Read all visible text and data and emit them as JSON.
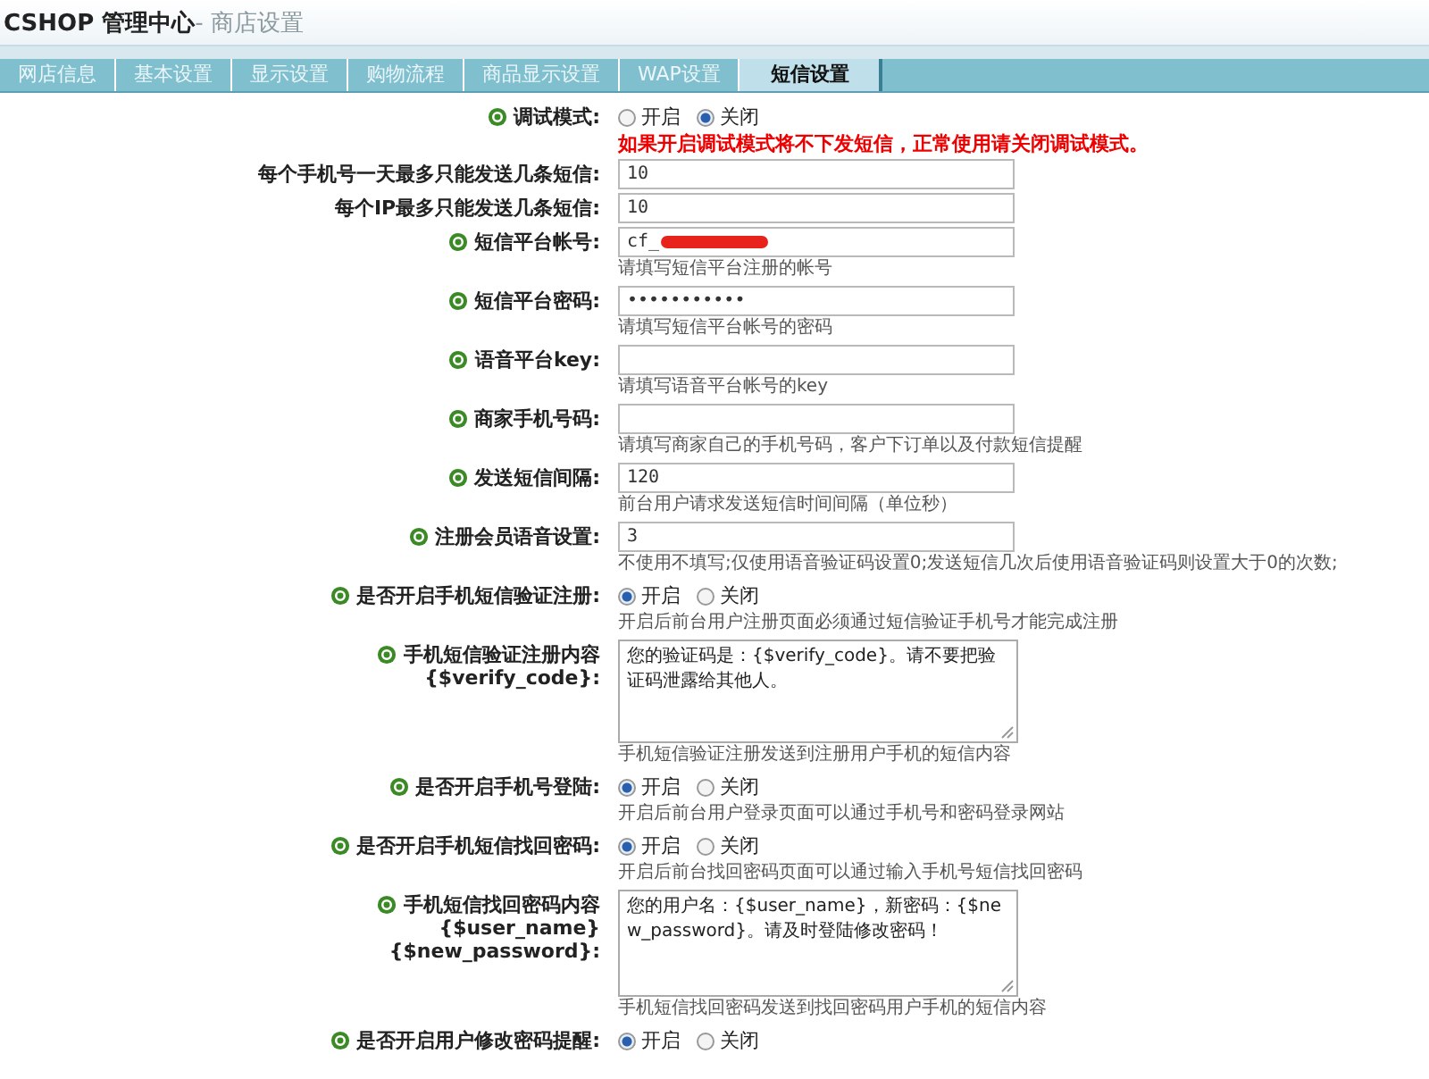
{
  "header": {
    "title": "CSHOP 管理中心",
    "subtitle": "- 商店设置"
  },
  "tabs": [
    {
      "label": "网店信息",
      "selected": false
    },
    {
      "label": "基本设置",
      "selected": false
    },
    {
      "label": "显示设置",
      "selected": false
    },
    {
      "label": "购物流程",
      "selected": false
    },
    {
      "label": "商品显示设置",
      "selected": false
    },
    {
      "label": "WAP设置",
      "selected": false
    },
    {
      "label": "短信设置",
      "selected": true
    }
  ],
  "fields": [
    {
      "kind": "radio",
      "help": true,
      "label": [
        "调试模式:"
      ],
      "options": [
        {
          "label": "开启",
          "selected": false
        },
        {
          "label": "关闭",
          "selected": true
        }
      ],
      "warning": "如果开启调试模式将不下发短信，正常使用请关闭调试模式。"
    },
    {
      "kind": "text",
      "help": false,
      "label": [
        "每个手机号一天最多只能发送几条短信:"
      ],
      "value": "10"
    },
    {
      "kind": "text",
      "help": false,
      "label": [
        "每个IP最多只能发送几条短信:"
      ],
      "value": "10"
    },
    {
      "kind": "text",
      "help": true,
      "label": [
        "短信平台帐号:"
      ],
      "value": "cf_",
      "redacted": true,
      "hint": "请填写短信平台注册的帐号"
    },
    {
      "kind": "password",
      "help": true,
      "label": [
        "短信平台密码:"
      ],
      "value": "•••••••••••",
      "hint": "请填写短信平台帐号的密码"
    },
    {
      "kind": "text",
      "help": true,
      "label": [
        "语音平台key:"
      ],
      "hint": "请填写语音平台帐号的key"
    },
    {
      "kind": "text",
      "help": true,
      "label": [
        "商家手机号码:"
      ],
      "hint": "请填写商家自己的手机号码，客户下订单以及付款短信提醒"
    },
    {
      "kind": "text",
      "help": true,
      "label": [
        "发送短信间隔:"
      ],
      "value": "120",
      "hint": "前台用户请求发送短信时间间隔（单位秒）"
    },
    {
      "kind": "text",
      "help": true,
      "label": [
        "注册会员语音设置:"
      ],
      "value": "3",
      "hint": "不使用不填写;仅使用语音验证码设置0;发送短信几次后使用语音验证码则设置大于0的次数;"
    },
    {
      "kind": "radio",
      "help": true,
      "label": [
        "是否开启手机短信验证注册:"
      ],
      "options": [
        {
          "label": "开启",
          "selected": true
        },
        {
          "label": "关闭",
          "selected": false
        }
      ],
      "hint": "开启后前台用户注册页面必须通过短信验证手机号才能完成注册"
    },
    {
      "kind": "textarea",
      "help": true,
      "label": [
        "手机短信验证注册内容",
        "{$verify_code}:"
      ],
      "value": "您的验证码是：{$verify_code}。请不要把验证码泄露给其他人。",
      "hint": "手机短信验证注册发送到注册用户手机的短信内容"
    },
    {
      "kind": "radio",
      "help": true,
      "label": [
        "是否开启手机号登陆:"
      ],
      "options": [
        {
          "label": "开启",
          "selected": true
        },
        {
          "label": "关闭",
          "selected": false
        }
      ],
      "hint": "开启后前台用户登录页面可以通过手机号和密码登录网站"
    },
    {
      "kind": "radio",
      "help": true,
      "label": [
        "是否开启手机短信找回密码:"
      ],
      "options": [
        {
          "label": "开启",
          "selected": true
        },
        {
          "label": "关闭",
          "selected": false
        }
      ],
      "hint": "开启后前台找回密码页面可以通过输入手机号短信找回密码"
    },
    {
      "kind": "textarea",
      "help": true,
      "label": [
        "手机短信找回密码内容",
        "{$user_name}",
        "{$new_password}:"
      ],
      "value": "您的用户名：{$user_name}，新密码：{$new_password}。请及时登陆修改密码！",
      "hint": "手机短信找回密码发送到找回密码用户手机的短信内容"
    },
    {
      "kind": "radio",
      "help": true,
      "label": [
        "是否开启用户修改密码提醒:"
      ],
      "options": [
        {
          "label": "开启",
          "selected": true
        },
        {
          "label": "关闭",
          "selected": false
        }
      ]
    }
  ]
}
